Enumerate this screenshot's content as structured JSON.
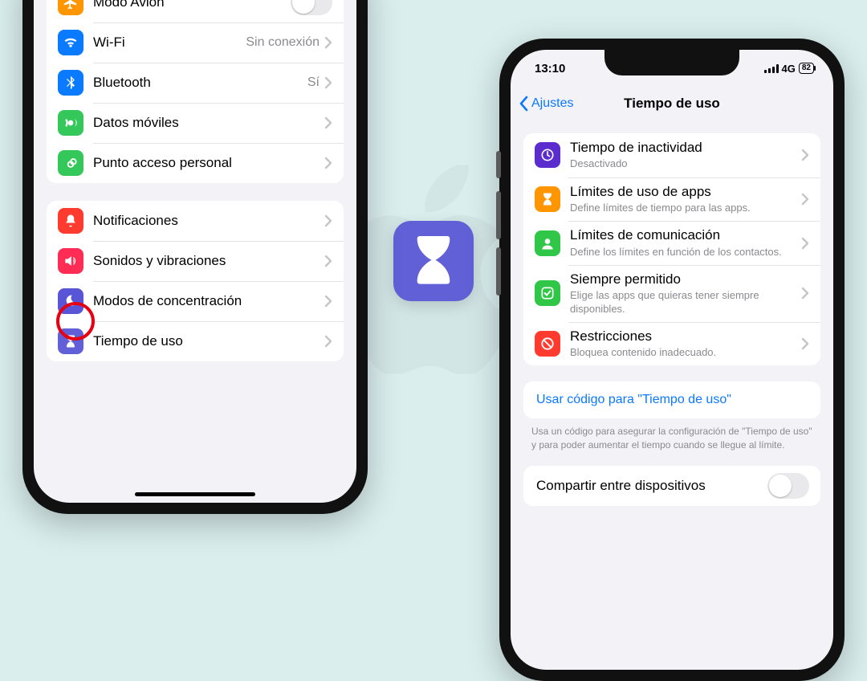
{
  "leftPhone": {
    "group1": {
      "airplane": {
        "label": "Modo Avión"
      },
      "wifi": {
        "label": "Wi-Fi",
        "detail": "Sin conexión"
      },
      "bluetooth": {
        "label": "Bluetooth",
        "detail": "Sí"
      },
      "cellular": {
        "label": "Datos móviles"
      },
      "hotspot": {
        "label": "Punto acceso personal"
      }
    },
    "group2": {
      "notifications": {
        "label": "Notificaciones"
      },
      "sounds": {
        "label": "Sonidos y vibraciones"
      },
      "focus": {
        "label": "Modos de concentración"
      },
      "screentime": {
        "label": "Tiempo de uso"
      }
    }
  },
  "rightPhone": {
    "status": {
      "time": "13:10",
      "network": "4G",
      "battery": "82"
    },
    "nav": {
      "back": "Ajustes",
      "title": "Tiempo de uso"
    },
    "rows": {
      "downtime": {
        "title": "Tiempo de inactividad",
        "sub": "Desactivado"
      },
      "applimit": {
        "title": "Límites de uso de apps",
        "sub": "Define límites de tiempo para las apps."
      },
      "comm": {
        "title": "Límites de comunicación",
        "sub": "Define los límites en función de los contactos."
      },
      "allowed": {
        "title": "Siempre permitido",
        "sub": "Elige las apps que quieras tener siempre disponibles."
      },
      "restrict": {
        "title": "Restricciones",
        "sub": "Bloquea contenido inadecuado."
      }
    },
    "codeLink": "Usar código para \"Tiempo de uso\"",
    "codeHint": "Usa un código para asegurar la configuración de \"Tiempo de uso\" y para poder aumentar el tiempo cuando se llegue al límite.",
    "share": {
      "label": "Compartir entre dispositivos"
    }
  }
}
